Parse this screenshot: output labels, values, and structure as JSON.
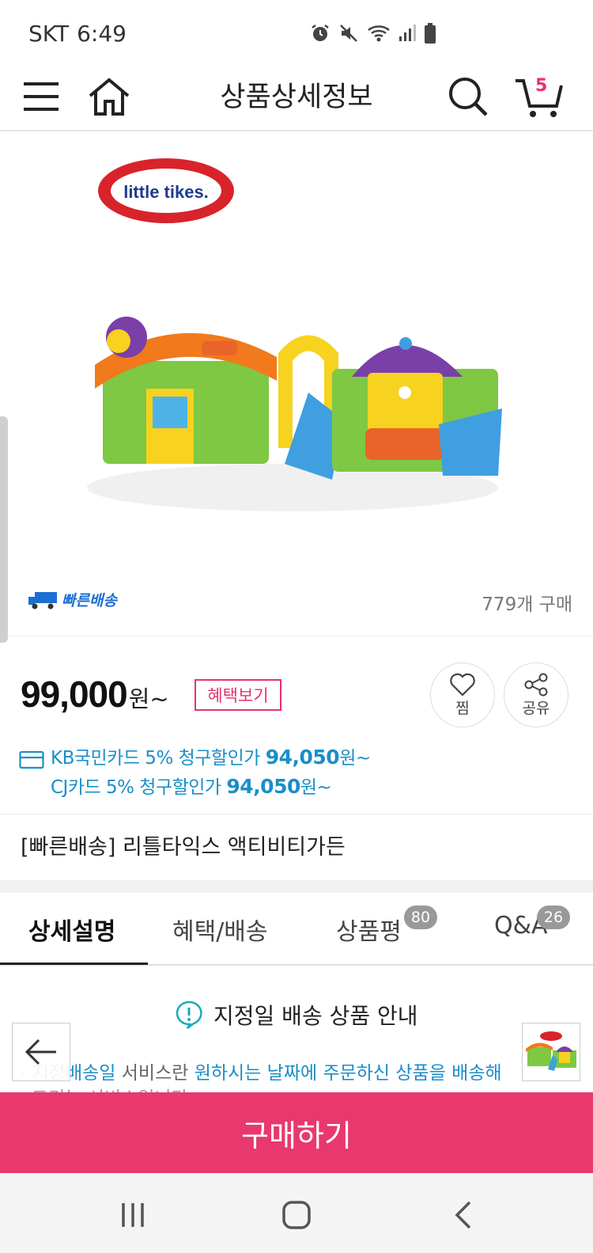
{
  "status_bar": {
    "carrier": "SKT",
    "time": "6:49"
  },
  "header": {
    "title": "상품상세정보",
    "cart_count": "5"
  },
  "product": {
    "logo_text": "little tikes.",
    "fast_delivery_badge": "빠른배송",
    "purchase_count": "779개 구매",
    "price": "99,000",
    "price_unit": "원~",
    "benefit_button": "혜택보기",
    "wish_label": "찜",
    "share_label": "공유",
    "card_discounts": [
      {
        "text": "KB국민카드 5% 청구할인가 ",
        "price": "94,050",
        "unit": "원~"
      },
      {
        "text": "CJ카드 5% 청구할인가 ",
        "price": "94,050",
        "unit": "원~"
      }
    ],
    "name": "[빠른배송] 리틀타익스 액티비티가든"
  },
  "tabs": [
    {
      "label": "상세설명",
      "badge": ""
    },
    {
      "label": "혜택/배송",
      "badge": ""
    },
    {
      "label": "상품평",
      "badge": "80"
    },
    {
      "label": "Q&A",
      "badge": "26"
    }
  ],
  "notice": {
    "title": "지정일 배송 상품 안내",
    "line1_hl1": "· 지정배송일",
    "line1_mid": " 서비스란 ",
    "line1_hl2": "원하시는 날짜에 주문하신 상품을 배송해",
    "line2": "드리는 서비스입니다."
  },
  "buy_button": "구매하기",
  "colors": {
    "accent": "#e8386e",
    "link_blue": "#1a8ec9",
    "delivery_blue": "#1b6fd3"
  }
}
